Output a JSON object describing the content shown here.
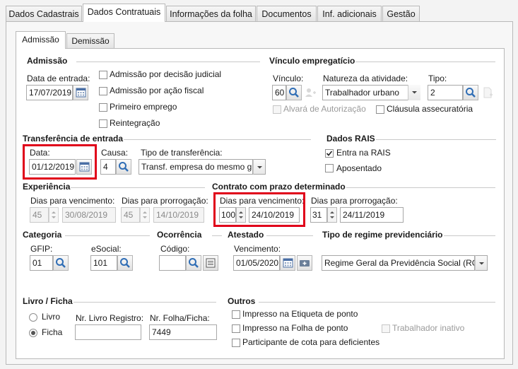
{
  "tabs": [
    "Dados Cadastrais",
    "Dados Contratuais",
    "Informações da folha",
    "Documentos",
    "Inf. adicionais",
    "Gestão"
  ],
  "subtabs": [
    "Admissão",
    "Demissão"
  ],
  "admissao": {
    "title": "Admissão",
    "data_entrada_label": "Data de entrada:",
    "data_entrada": "17/07/2019",
    "checks": [
      "Admissão por decisão judicial",
      "Admissão por ação fiscal",
      "Primeiro emprego",
      "Reintegração"
    ]
  },
  "vinculo": {
    "title": "Vínculo empregatício",
    "vinculo_label": "Vínculo:",
    "vinculo_value": "60",
    "natureza_label": "Natureza da atividade:",
    "natureza_value": "Trabalhador urbano",
    "tipo_label": "Tipo:",
    "tipo_value": "2",
    "alvara_label": "Alvará de Autorização",
    "clausula_label": "Cláusula assecuratória"
  },
  "transferencia": {
    "title": "Transferência de entrada",
    "data_label": "Data:",
    "data_value": "01/12/2019",
    "causa_label": "Causa:",
    "causa_value": "4",
    "tipo_label": "Tipo de transferência:",
    "tipo_value": "Transf. empresa do mesmo gr"
  },
  "rais": {
    "title": "Dados RAIS",
    "entra_label": "Entra na RAIS",
    "entra_checked": true,
    "aposentado_label": "Aposentado"
  },
  "experiencia": {
    "title": "Experiência",
    "venc_label": "Dias para vencimento:",
    "venc_dias": "45",
    "venc_data": "30/08/2019",
    "prorr_label": "Dias para prorrogação:",
    "prorr_dias": "45",
    "prorr_data": "14/10/2019"
  },
  "contrato": {
    "title": "Contrato com prazo determinado",
    "venc_label": "Dias para vencimento:",
    "venc_dias": "100",
    "venc_data": "24/10/2019",
    "prorr_label": "Dias para prorrogação:",
    "prorr_dias": "31",
    "prorr_data": "24/11/2019"
  },
  "categoria": {
    "title": "Categoria",
    "gfip_label": "GFIP:",
    "gfip_value": "01",
    "esocial_label": "eSocial:",
    "esocial_value": "101"
  },
  "ocorrencia": {
    "title": "Ocorrência",
    "codigo_label": "Código:",
    "codigo_value": ""
  },
  "atestado": {
    "title": "Atestado",
    "venc_label": "Vencimento:",
    "venc_value": "01/05/2020"
  },
  "regime": {
    "title": "Tipo de regime previdenciário",
    "value": "Regime Geral da Previdência Social (RGP"
  },
  "livro": {
    "title": "Livro / Ficha",
    "opt_livro": "Livro",
    "opt_ficha": "Ficha",
    "selected": "Ficha",
    "nr_livro_label": "Nr. Livro Registro:",
    "nr_livro_value": "",
    "nr_folha_label": "Nr. Folha/Ficha:",
    "nr_folha_value": "7449"
  },
  "outros": {
    "title": "Outros",
    "checks": [
      "Impresso na Etiqueta de ponto",
      "Impresso na Folha de ponto",
      "Participante de cota para deficientes"
    ],
    "trabalhador_inativo": "Trabalhador inativo"
  },
  "colors": {
    "highlight": "#e0001a",
    "icon_blue": "#2f6db5"
  }
}
